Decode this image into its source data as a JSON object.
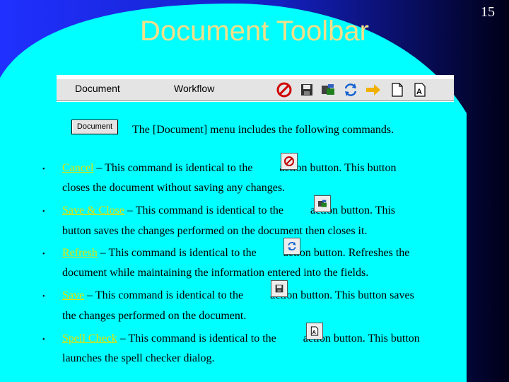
{
  "slide": {
    "title": "Document Toolbar",
    "page_number": "15"
  },
  "toolbar": {
    "menus": [
      "Document",
      "Workflow"
    ],
    "icons": [
      "cancel-icon",
      "save-icon",
      "save-and-close-icon",
      "refresh-icon",
      "forward-arrow-icon",
      "blank-document-icon",
      "spell-check-icon"
    ]
  },
  "document_chip": "Document",
  "intro": "The [Document] menu includes the following commands.",
  "bullets": [
    {
      "link": "Cancel",
      "before_icon": " – This command is identical to the ",
      "after_icon": " action button.  This button",
      "line2": "closes the document without saving any changes.",
      "icon": "cancel-icon"
    },
    {
      "link": "Save & Close",
      "before_icon": " – This command is identical to the ",
      "after_icon": " action button.  This",
      "line2": "button saves the changes performed on the document then closes it.",
      "icon": "save-and-close-icon"
    },
    {
      "link": "Refresh",
      "before_icon": " – This command is identical to the ",
      "after_icon": " action button.  Refreshes the",
      "line2": "document while maintaining the information entered into the fields.",
      "icon": "refresh-icon"
    },
    {
      "link": "Save",
      "before_icon": " – This command is identical to the ",
      "after_icon": " action button.  This button saves",
      "line2": "the changes performed on the document.",
      "icon": "save-icon"
    },
    {
      "link": "Spell Check",
      "before_icon": " – This command is identical to the ",
      "after_icon": " action button.  This button",
      "line2": "launches the spell checker dialog.",
      "icon": "spell-check-icon"
    }
  ],
  "colors": {
    "cyan": "#00ffff",
    "blue": "#2b3fff",
    "navy": "#000033",
    "title": "#f2e08a",
    "link": "#e8e000"
  }
}
